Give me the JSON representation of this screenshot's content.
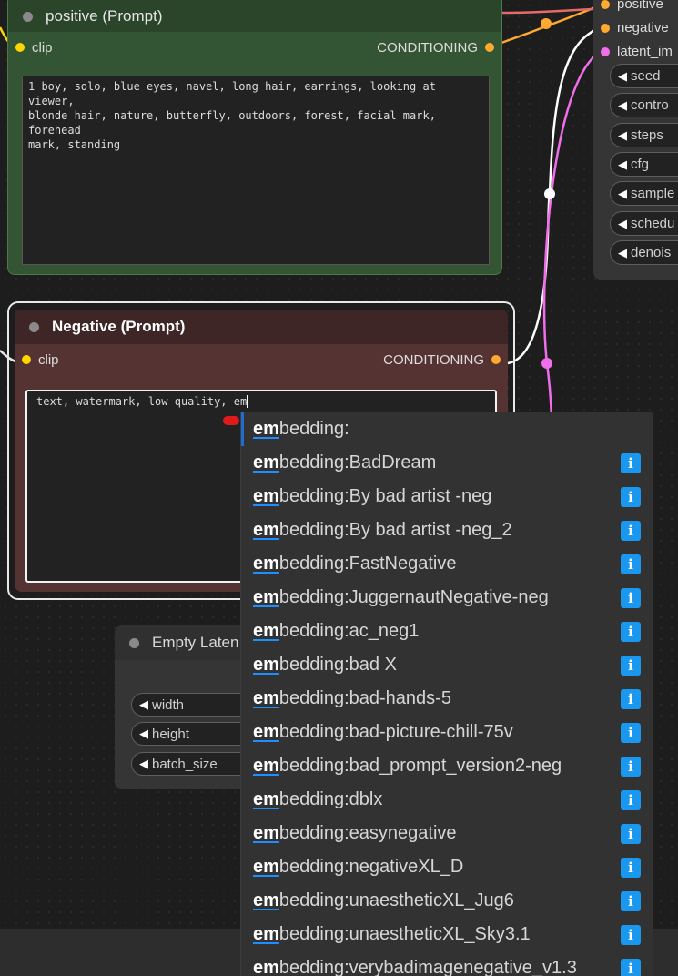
{
  "colors": {
    "positive_node": "#335533",
    "negative_node": "#553333",
    "clip_port": "#ffd500",
    "conditioning_port": "#ffa931",
    "latent_port": "#f06ee9",
    "accent": "#1e6dd6",
    "info_badge": "#1a97ef"
  },
  "positive_node": {
    "title": "positive (Prompt)",
    "input_label": "clip",
    "output_label": "CONDITIONING",
    "prompt_text": "1 boy, solo, blue eyes, navel, long hair, earrings, looking at viewer,\nblonde hair, nature, butterfly, outdoors, forest, facial mark, forehead\nmark, standing"
  },
  "negative_node": {
    "title": "Negative (Prompt)",
    "input_label": "clip",
    "output_label": "CONDITIONING",
    "prompt_text": "text, watermark, low quality, em"
  },
  "latent_node": {
    "title": "Empty Laten",
    "widgets": [
      "width",
      "height",
      "batch_size"
    ]
  },
  "ksampler": {
    "inputs": [
      "positive",
      "negative",
      "latent_im"
    ],
    "widgets": [
      "seed",
      "contro",
      "steps",
      "cfg",
      "sample",
      "schedu",
      "denois"
    ]
  },
  "autocomplete": {
    "typed_prefix": "em",
    "info_label": "i",
    "items": [
      {
        "suffix": "bedding:",
        "has_info": false
      },
      {
        "suffix": "bedding:BadDream",
        "has_info": true
      },
      {
        "suffix": "bedding:By bad artist -neg",
        "has_info": true
      },
      {
        "suffix": "bedding:By bad artist -neg_2",
        "has_info": true
      },
      {
        "suffix": "bedding:FastNegative",
        "has_info": true
      },
      {
        "suffix": "bedding:JuggernautNegative-neg",
        "has_info": true
      },
      {
        "suffix": "bedding:ac_neg1",
        "has_info": true
      },
      {
        "suffix": "bedding:bad X",
        "has_info": true
      },
      {
        "suffix": "bedding:bad-hands-5",
        "has_info": true
      },
      {
        "suffix": "bedding:bad-picture-chill-75v",
        "has_info": true
      },
      {
        "suffix": "bedding:bad_prompt_version2-neg",
        "has_info": true
      },
      {
        "suffix": "bedding:dblx",
        "has_info": true
      },
      {
        "suffix": "bedding:easynegative",
        "has_info": true
      },
      {
        "suffix": "bedding:negativeXL_D",
        "has_info": true
      },
      {
        "suffix": "bedding:unaestheticXL_Jug6",
        "has_info": true
      },
      {
        "suffix": "bedding:unaestheticXL_Sky3.1",
        "has_info": true
      },
      {
        "suffix": "bedding:verybadimagenegative_v1.3",
        "has_info": true
      }
    ]
  }
}
